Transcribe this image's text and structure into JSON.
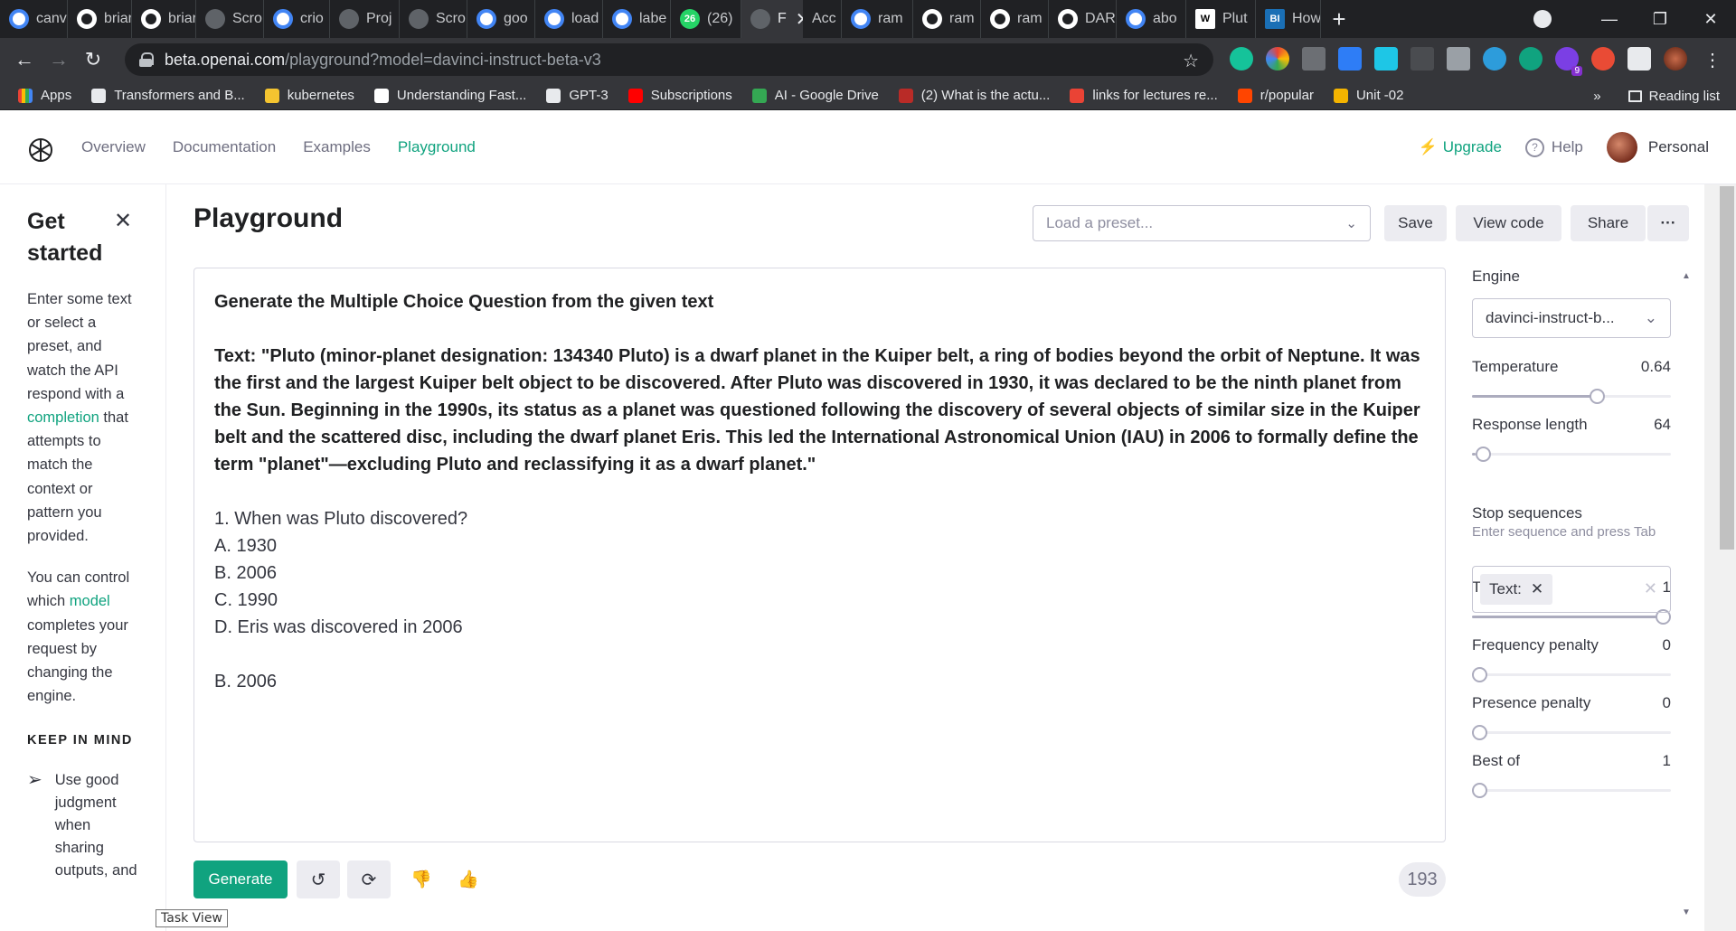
{
  "browser": {
    "tabs": [
      {
        "label": "canv",
        "icon": "google-icon"
      },
      {
        "label": "briar",
        "icon": "github-icon"
      },
      {
        "label": "briar",
        "icon": "github-icon"
      },
      {
        "label": "Scro",
        "icon": "generic-icon"
      },
      {
        "label": "crio",
        "icon": "google-icon"
      },
      {
        "label": "Proj",
        "icon": "generic-icon"
      },
      {
        "label": "Scro",
        "icon": "generic-icon"
      },
      {
        "label": "goo",
        "icon": "google-icon"
      },
      {
        "label": "load",
        "icon": "google-icon"
      },
      {
        "label": "labe",
        "icon": "google-icon"
      },
      {
        "label": "(26)",
        "icon": "whatsapp-icon",
        "badge": "26"
      },
      {
        "label": "F",
        "icon": "openai-icon",
        "active": true
      },
      {
        "label": "Acc",
        "icon": "none"
      },
      {
        "label": "ram",
        "icon": "google-icon"
      },
      {
        "label": "ram",
        "icon": "github-icon"
      },
      {
        "label": "ram",
        "icon": "github-icon"
      },
      {
        "label": "DAR",
        "icon": "github-icon"
      },
      {
        "label": "abo",
        "icon": "google-icon"
      },
      {
        "label": "Plut",
        "icon": "wikipedia-icon",
        "fav_text": "W"
      },
      {
        "label": "How",
        "icon": "bi-icon",
        "fav_text": "BI"
      }
    ],
    "new_tab": "+",
    "close_tab": "✕",
    "window": {
      "minimize": "—",
      "restore": "❐",
      "close": "✕"
    },
    "url_domain": "beta.openai.com",
    "url_path": "/playground?model=davinci-instruct-beta-v3",
    "bookmarks": [
      {
        "label": "Apps",
        "color": "#ea4335"
      },
      {
        "label": "Transformers and B...",
        "color": "#e8eaed"
      },
      {
        "label": "kubernetes",
        "color": "#f4c430"
      },
      {
        "label": "Understanding Fast...",
        "color": "#ffffff"
      },
      {
        "label": "GPT-3",
        "color": "#e8eaed"
      },
      {
        "label": "Subscriptions",
        "color": "#ff0000"
      },
      {
        "label": "AI - Google Drive",
        "color": "#34a853"
      },
      {
        "label": "(2) What is the actu...",
        "color": "#b92b27"
      },
      {
        "label": "links for lectures re...",
        "color": "#ea4335"
      },
      {
        "label": "r/popular",
        "color": "#ff4500"
      },
      {
        "label": "Unit -02",
        "color": "#f4b400"
      }
    ],
    "bookmarks_more": "»",
    "reading_list": "Reading list",
    "ext_badge": "9"
  },
  "app": {
    "nav": [
      "Overview",
      "Documentation",
      "Examples",
      "Playground"
    ],
    "active_nav": "Playground",
    "upgrade": "Upgrade",
    "help": "Help",
    "account": "Personal",
    "accent": "#10a37f"
  },
  "sidebar": {
    "title": "Get started",
    "intro_before": "Enter some text or select a preset, and watch the API respond with a ",
    "intro_link": "completion",
    "intro_after": " that attempts to match the context or pattern you provided.",
    "model_before": "You can control which ",
    "model_link": "model",
    "model_after": " completes your request by changing the engine.",
    "keep_in_mind": "KEEP IN MIND",
    "tip": "Use good judgment when sharing outputs, and"
  },
  "main": {
    "title": "Playground",
    "preset_placeholder": "Load a preset...",
    "save": "Save",
    "view_code": "View code",
    "share": "Share",
    "more": "···",
    "prompt_heading": "Generate the Multiple Choice Question from the given text",
    "prompt_text": "Text: \"Pluto (minor-planet designation: 134340 Pluto) is a dwarf planet in the Kuiper belt, a ring of bodies beyond the orbit of Neptune. It was the first and the largest Kuiper belt object to be discovered. After Pluto was discovered in 1930, it was declared to be the ninth planet from the Sun. Beginning in the 1990s, its status as a planet was questioned following the discovery of several objects of similar size in the Kuiper belt and the scattered disc, including the dwarf planet Eris. This led the International Astronomical Union (IAU) in 2006 to formally define the term \"planet\"—excluding Pluto and reclassifying it as a dwarf planet.\"",
    "completion_lines": [
      "1. When was Pluto discovered?",
      "A. 1930",
      "B. 2006",
      "C. 1990",
      "D. Eris was discovered in 2006",
      "",
      "B. 2006"
    ],
    "generate": "Generate",
    "token_count": "193",
    "tooltip": "Task View"
  },
  "settings": {
    "engine_label": "Engine",
    "engine_value": "davinci-instruct-b...",
    "params": [
      {
        "label": "Temperature",
        "value": "0.64",
        "fraction": 0.64
      },
      {
        "label": "Response length",
        "value": "64",
        "fraction": 0.02
      },
      {
        "label": "Top P",
        "value": "1",
        "fraction": 1.0
      },
      {
        "label": "Frequency penalty",
        "value": "0",
        "fraction": 0.0
      },
      {
        "label": "Presence penalty",
        "value": "0",
        "fraction": 0.0
      },
      {
        "label": "Best of",
        "value": "1",
        "fraction": 0.0
      }
    ],
    "stop_label": "Stop sequences",
    "stop_hint": "Enter sequence and press Tab",
    "stop_chip": "Text:"
  }
}
